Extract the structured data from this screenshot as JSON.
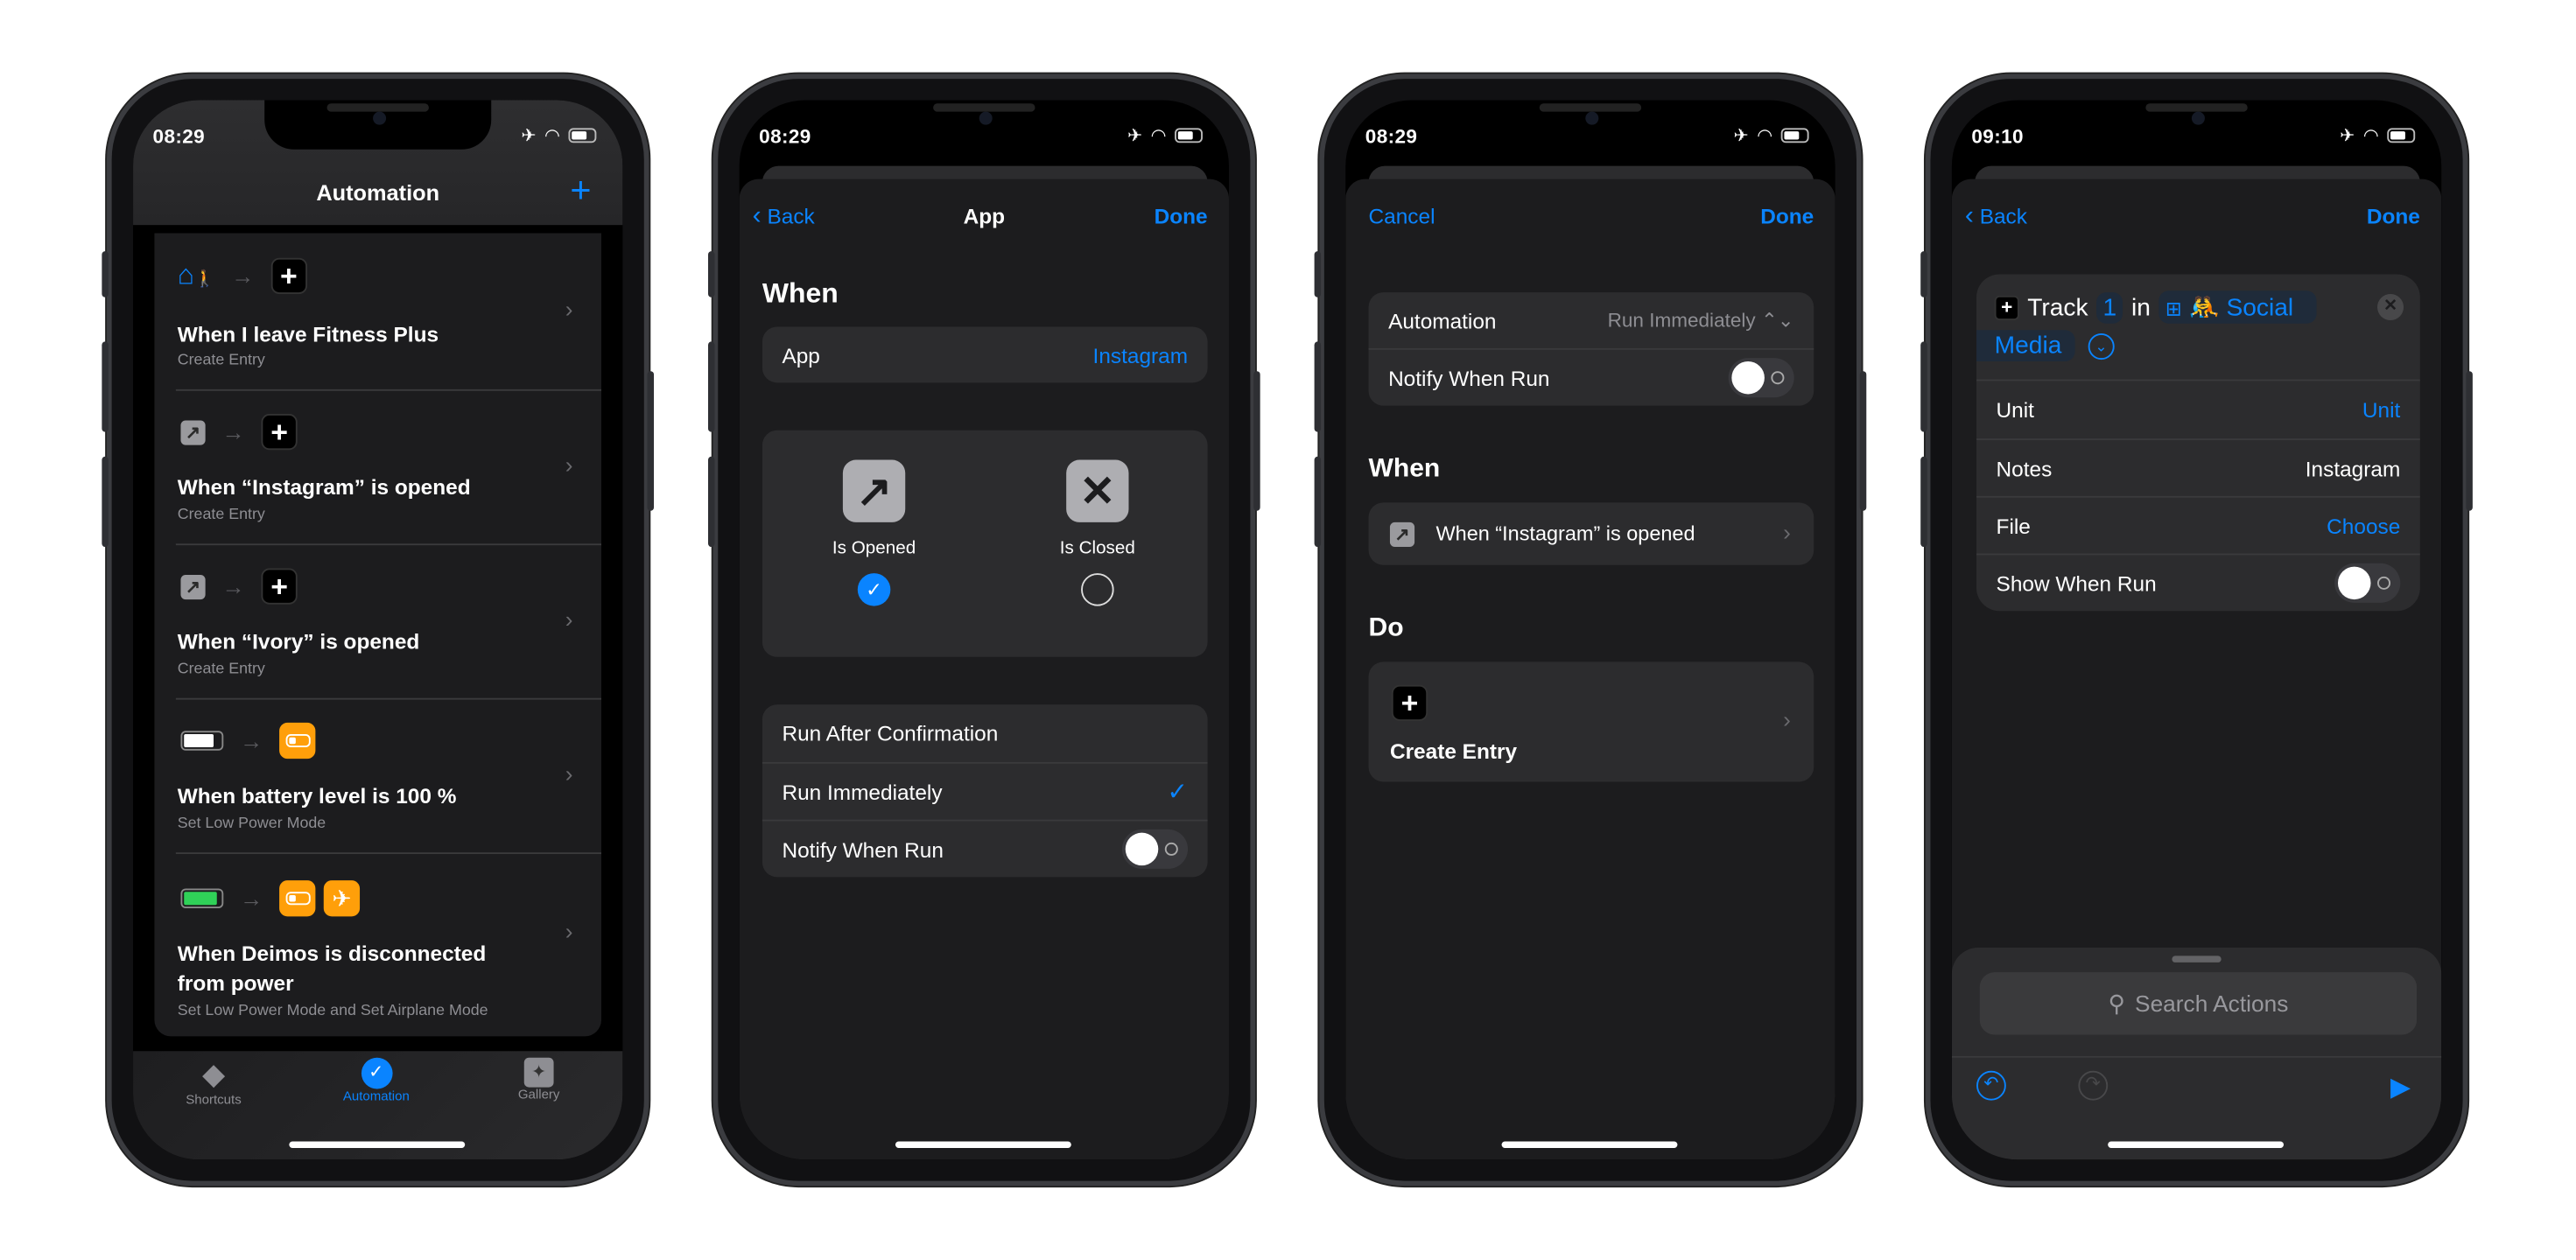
{
  "colors": {
    "accent": "#0a84ff",
    "orange": "#ff9f0a",
    "card": "#2c2c2e",
    "sheet": "#1c1c1e"
  },
  "phone1": {
    "time": "08:29",
    "title": "Automation",
    "add_icon": "plus-icon",
    "automations": [
      {
        "title": "When I leave Fitness Plus",
        "subtitle": "Create Entry",
        "trigger_icon": "home-leave-icon"
      },
      {
        "title": "When “Instagram” is opened",
        "subtitle": "Create Entry",
        "trigger_icon": "app-open-icon"
      },
      {
        "title": "When “Ivory” is opened",
        "subtitle": "Create Entry",
        "trigger_icon": "app-open-icon"
      },
      {
        "title": "When battery level is 100 %",
        "subtitle": "Set Low Power Mode",
        "trigger_icon": "battery-icon"
      },
      {
        "title": "When Deimos is disconnected from power",
        "subtitle": "Set Low Power Mode and Set Airplane Mode",
        "trigger_icon": "battery-charging-icon"
      }
    ],
    "tabs": [
      {
        "label": "Shortcuts",
        "active": false
      },
      {
        "label": "Automation",
        "active": true
      },
      {
        "label": "Gallery",
        "active": false
      }
    ]
  },
  "phone2": {
    "time": "08:29",
    "back": "Back",
    "title": "App",
    "done": "Done",
    "when": "When",
    "app_label": "App",
    "app_value": "Instagram",
    "opened": "Is Opened",
    "closed": "Is Closed",
    "opened_selected": true,
    "options": [
      "Run After Confirmation",
      "Run Immediately",
      "Notify When Run"
    ],
    "selected_option": "Run Immediately",
    "notify": false
  },
  "phone3": {
    "time": "08:29",
    "cancel": "Cancel",
    "done": "Done",
    "automation_label": "Automation",
    "automation_value": "Run Immediately",
    "notify_label": "Notify When Run",
    "notify": false,
    "when": "When",
    "trigger": "When “Instagram” is opened",
    "do": "Do",
    "action": "Create Entry"
  },
  "phone4": {
    "time": "09:10",
    "back": "Back",
    "done": "Done",
    "action": {
      "verb": "Track",
      "count": "1",
      "in": "in",
      "target_emoji": "🤼",
      "target": "Social",
      "target2": "Media"
    },
    "rows": [
      {
        "label": "Unit",
        "value": "Unit"
      },
      {
        "label": "Notes",
        "value": "Instagram"
      },
      {
        "label": "File",
        "value": "Choose"
      },
      {
        "label": "Show When Run"
      }
    ],
    "show_when_run": false,
    "search_placeholder": "Search Actions"
  }
}
